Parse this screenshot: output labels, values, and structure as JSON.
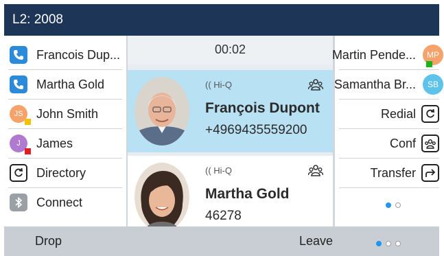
{
  "header": {
    "line_label": "L2: 2008"
  },
  "left_keys": [
    {
      "label": "Francois Dup...",
      "icon": "phone-icon"
    },
    {
      "label": "Martha Gold",
      "icon": "phone-icon"
    },
    {
      "label": "John Smith",
      "initials": "JS",
      "avatar_color": "#f5a36b",
      "status_color": "#f2c200"
    },
    {
      "label": "James",
      "initials": "J",
      "avatar_color": "#b07ad1",
      "status_color": "#e02020"
    },
    {
      "label": "Directory",
      "icon": "directory-icon"
    },
    {
      "label": "Connect",
      "icon": "bluetooth-icon"
    }
  ],
  "calls": {
    "timer": "00:02",
    "items": [
      {
        "name": "François Dupont",
        "number": "+4969435559200",
        "hd_label": "Hi-Q",
        "state": "active"
      },
      {
        "name": "Martha Gold",
        "number": "46278",
        "hd_label": "Hi-Q",
        "state": "held"
      }
    ]
  },
  "right_keys": [
    {
      "label": "Martin Pende...",
      "initials": "MP",
      "avatar_color": "#f5a36b",
      "status_color": "#1db31d"
    },
    {
      "label": "Samantha Br...",
      "initials": "SB",
      "avatar_color": "#5ec3ea"
    },
    {
      "label": "Redial",
      "icon": "redial-icon"
    },
    {
      "label": "Conf",
      "icon": "conference-icon"
    },
    {
      "label": "Transfer",
      "icon": "transfer-icon"
    }
  ],
  "softkeys": {
    "drop": "Drop",
    "leave": "Leave"
  },
  "colors": {
    "header_bg": "#1d3557",
    "active_call_bg": "#b9e1f4",
    "accent": "#2196f3"
  }
}
